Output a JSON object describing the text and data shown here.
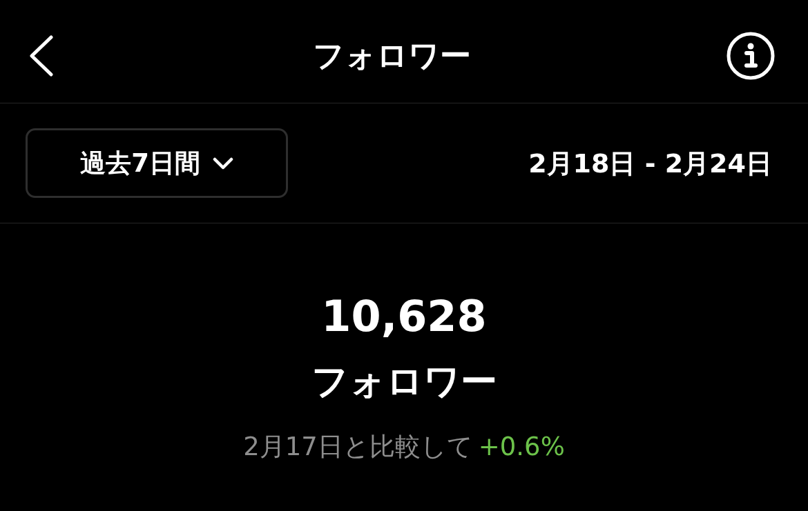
{
  "header": {
    "title": "フォロワー"
  },
  "filter": {
    "period": "過去7日間",
    "range": "2月18日 - 2月24日"
  },
  "summary": {
    "count": "10,628",
    "label": "フォロワー",
    "comparison": "2月17日と比較して",
    "change": {
      "text": "+0.6%",
      "positive": true
    }
  }
}
